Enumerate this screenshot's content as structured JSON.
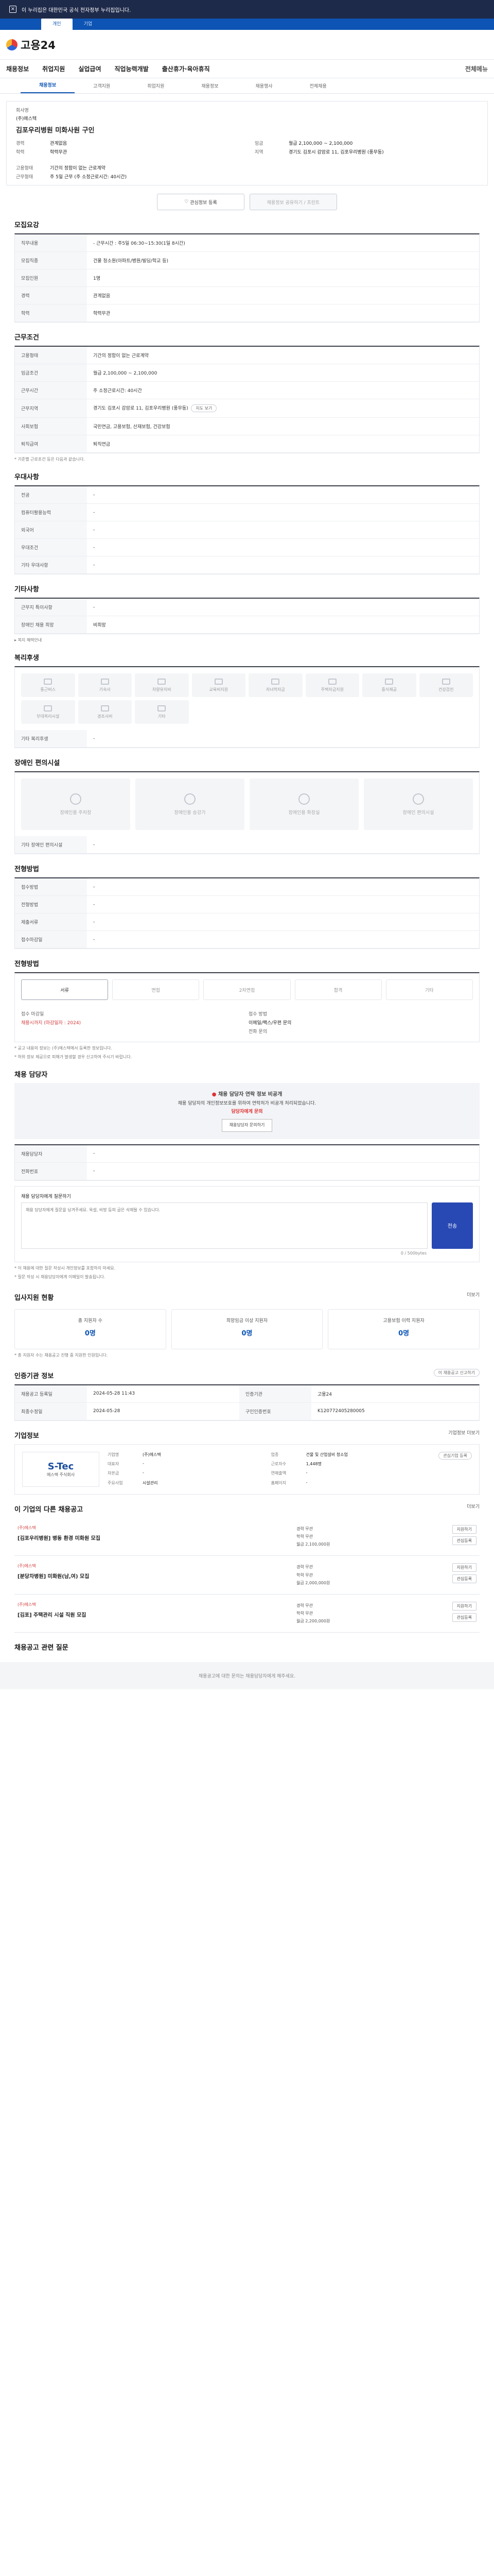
{
  "topbar": {
    "notice": "이 누리집은 대한민국 공식 전자정부 누리집입니다.",
    "tabs": [
      "개인",
      "기업"
    ]
  },
  "header": {
    "logo": "고용24"
  },
  "gnb": {
    "items": [
      "채용정보",
      "취업지원",
      "실업급여",
      "직업능력개발",
      "출산휴가·육아휴직"
    ],
    "right": "전체메뉴"
  },
  "snb": {
    "items": [
      "채용정보",
      "고객지원",
      "취업지원",
      "채용정보",
      "채용행사",
      "전체채용"
    ]
  },
  "job": {
    "company_label": "회사명",
    "company": "(주)에스텍",
    "title": "김포우리병원 미화사원 구인",
    "info": [
      {
        "k": "경력",
        "v": "관계없음"
      },
      {
        "k": "학력",
        "v": "학력무관"
      },
      {
        "k": "임금",
        "v": "월급 2,100,000 ~ 2,100,000"
      },
      {
        "k": "지역",
        "v": "경기도 김포시 감암로 11, 김포우리병원 (풍무동)"
      }
    ],
    "type_label": "고용형태",
    "type": "기간의 정함이 없는 근로계약",
    "hours_label": "근무형태",
    "hours": "주 5일 근무 (주 소정근로시간: 40시간)",
    "btn_interest": "관심정보 등록",
    "btn_share": "채용정보 공유하기 / 프린트"
  },
  "recruit": {
    "title": "모집요강",
    "rows": [
      {
        "k": "직무내용",
        "v": "- 근무시간 : 주5일 06:30~15:30(1일 8시간)"
      },
      {
        "k": "모집직종",
        "v": "건물 청소원(아파트/병원/빌딩/학교 등)"
      },
      {
        "k": "모집인원",
        "v": "1명"
      },
      {
        "k": "경력",
        "v": "관계없음"
      },
      {
        "k": "학력",
        "v": "학력무관"
      }
    ]
  },
  "cond": {
    "title": "근무조건",
    "rows": [
      {
        "k": "고용형태",
        "v": "기간의 정함이 없는 근로계약"
      },
      {
        "k": "임금조건",
        "v": "월급 2,100,000 ~ 2,100,000"
      },
      {
        "k": "근무시간",
        "v": "주 소정근로시간: 40시간"
      },
      {
        "k": "근무지역",
        "v": "경기도 김포시 감암로 11, 김포우리병원 (풍무동)"
      },
      {
        "k": "사회보험",
        "v": "국민연금, 고용보험, 산재보험, 건강보험"
      },
      {
        "k": "퇴직급여",
        "v": "퇴직연금"
      }
    ],
    "map_btn": "지도 보기"
  },
  "cond_note": "* 기준별 근로조건 등은 다음과 같습니다.",
  "pref": {
    "title": "우대사항",
    "rows": [
      {
        "k": "전공",
        "v": "-"
      },
      {
        "k": "컴퓨터활용능력",
        "v": "-"
      },
      {
        "k": "외국어",
        "v": "-"
      },
      {
        "k": "우대조건",
        "v": "-"
      },
      {
        "k": "기타 우대사항",
        "v": "-"
      }
    ]
  },
  "etc": {
    "title": "기타사항",
    "rows": [
      {
        "k": "근무지 특이사항",
        "v": "-"
      },
      {
        "k": "장애인 채용 희망",
        "v": "비희망"
      }
    ],
    "link": "복지 혜택안내"
  },
  "welfare": {
    "title": "복리후생",
    "items": [
      "통근버스",
      "기숙사",
      "차량유지비",
      "교육비지원",
      "자녀학자금",
      "주택자금지원",
      "중식제공",
      "건강검진"
    ],
    "items2": [
      "부대복리시설",
      "경조사비",
      "기타"
    ],
    "extra_k": "기타 복리후생",
    "extra_v": "-"
  },
  "disabled": {
    "title": "장애인 편의시설",
    "items": [
      "장애인용 주차장",
      "장애인용 승강기",
      "장애인용 화장실",
      "장애인 편의시설"
    ],
    "extra_k": "기타 장애인 편의시설",
    "extra_v": "-"
  },
  "apply": {
    "title": "전형방법",
    "rows": [
      {
        "k": "접수방법",
        "v": "-"
      },
      {
        "k": "전형방법",
        "v": "-"
      },
      {
        "k": "제출서류",
        "v": "-"
      },
      {
        "k": "접수마감일",
        "v": "-"
      }
    ]
  },
  "process": {
    "title": "전형방법",
    "steps": [
      "서류",
      "면접",
      "2차면접",
      "합격",
      "기타"
    ],
    "left_k": "접수 마감일",
    "left_v": "채용시까지 (마감일자 : 2024)",
    "right_k": "접수 방법",
    "right_v": "이메일/팩스/우편 문의",
    "extra": "전화 문의"
  },
  "notes": [
    "* 공고 내용의 정보는 (주)에스텍에서 등록한 정보입니다.",
    "* 허위 정보 제공으로 피해가 발생할 경우 신고하여 주시기 바랍니다."
  ],
  "contact": {
    "title": "채용 담당자",
    "alert_title": "채용 담당자 연락 정보 비공개",
    "alert_body": "채용 담당자의 개인정보보호를 위하여 연락처가 비공개 처리되었습니다.",
    "alert_red": "담당자에게 문의",
    "alert_btn": "채용담당자 문의하기",
    "rows": [
      {
        "k": "채용담당자",
        "v": "-"
      },
      {
        "k": "전화번호",
        "v": "-"
      }
    ]
  },
  "question": {
    "label": "채용 담당자에게 질문하기",
    "placeholder": "채용 담당자에게 질문을 남겨주세요. 욕설, 비방 등의 글은 삭제될 수 있습니다.",
    "count": "0 / 500bytes",
    "send": "전송",
    "notes": [
      "* 이 채용에 대한 질문 작성시 개인정보를 포함하지 마세요.",
      "* 질문 작성 시 채용담당자에게 이메일이 발송됩니다."
    ]
  },
  "stats": {
    "title": "입사지원 현황",
    "more": "더보기",
    "items": [
      {
        "label": "총 지원자 수",
        "value": "0명"
      },
      {
        "label": "희망임금 이상 지원자",
        "value": "0명"
      },
      {
        "label": "고용보험 이력 지원자",
        "value": "0명"
      }
    ],
    "note": "* 총 지원자 수는 채용공고 진행 중 지원한 인원입니다."
  },
  "meta": {
    "title": "인증기관 정보",
    "rows": [
      {
        "k": "채용공고 등록일",
        "v": "2024-05-28 11:43"
      },
      {
        "k": "인증기관",
        "v": "고용24"
      },
      {
        "k": "최종수정일",
        "v": "2024-05-28"
      },
      {
        "k": "구인인증번호",
        "v": "K120772405280005"
      }
    ],
    "link": "이 채용공고 신고하기"
  },
  "company": {
    "title": "기업정보",
    "more": "기업정보 더보기",
    "logo_text": "S-Tec",
    "logo_sub": "에스텍 주식회사",
    "rows": [
      {
        "k": "기업명",
        "v": "(주)에스텍"
      },
      {
        "k": "업종",
        "v": "건물 및 산업설비 청소업"
      },
      {
        "k": "대표자",
        "v": "-"
      },
      {
        "k": "근로자수",
        "v": "1,448명"
      },
      {
        "k": "자본금",
        "v": "-"
      },
      {
        "k": "연매출액",
        "v": "-"
      },
      {
        "k": "주요사업",
        "v": "시설관리"
      },
      {
        "k": "홈페이지",
        "v": "-"
      }
    ],
    "follow": "관심기업 등록"
  },
  "similar": {
    "title": "이 기업의 다른 채용공고",
    "more": "더보기",
    "items": [
      {
        "co": "(주)에스텍",
        "title": "[김포우리병원] 병동 환경 미화원 모집",
        "m": [
          "경력 무관",
          "학력 무관",
          "월급 2,100,000원"
        ],
        "a": [
          "지원하기",
          "관심등록"
        ]
      },
      {
        "co": "(주)에스텍",
        "title": "[분당차병원] 미화원(남,여) 모집",
        "m": [
          "경력 무관",
          "학력 무관",
          "월급 2,000,000원"
        ],
        "a": [
          "지원하기",
          "관심등록"
        ]
      },
      {
        "co": "(주)에스텍",
        "title": "[김포] 주택관리 시설 직원 모집",
        "m": [
          "경력 무관",
          "학력 무관",
          "월급 2,200,000원"
        ],
        "a": [
          "지원하기",
          "관심등록"
        ]
      }
    ]
  },
  "footer": {
    "title": "채용공고 관련 질문",
    "text": "채용공고에 대한 문의는 채용담당자에게 해주세요."
  }
}
